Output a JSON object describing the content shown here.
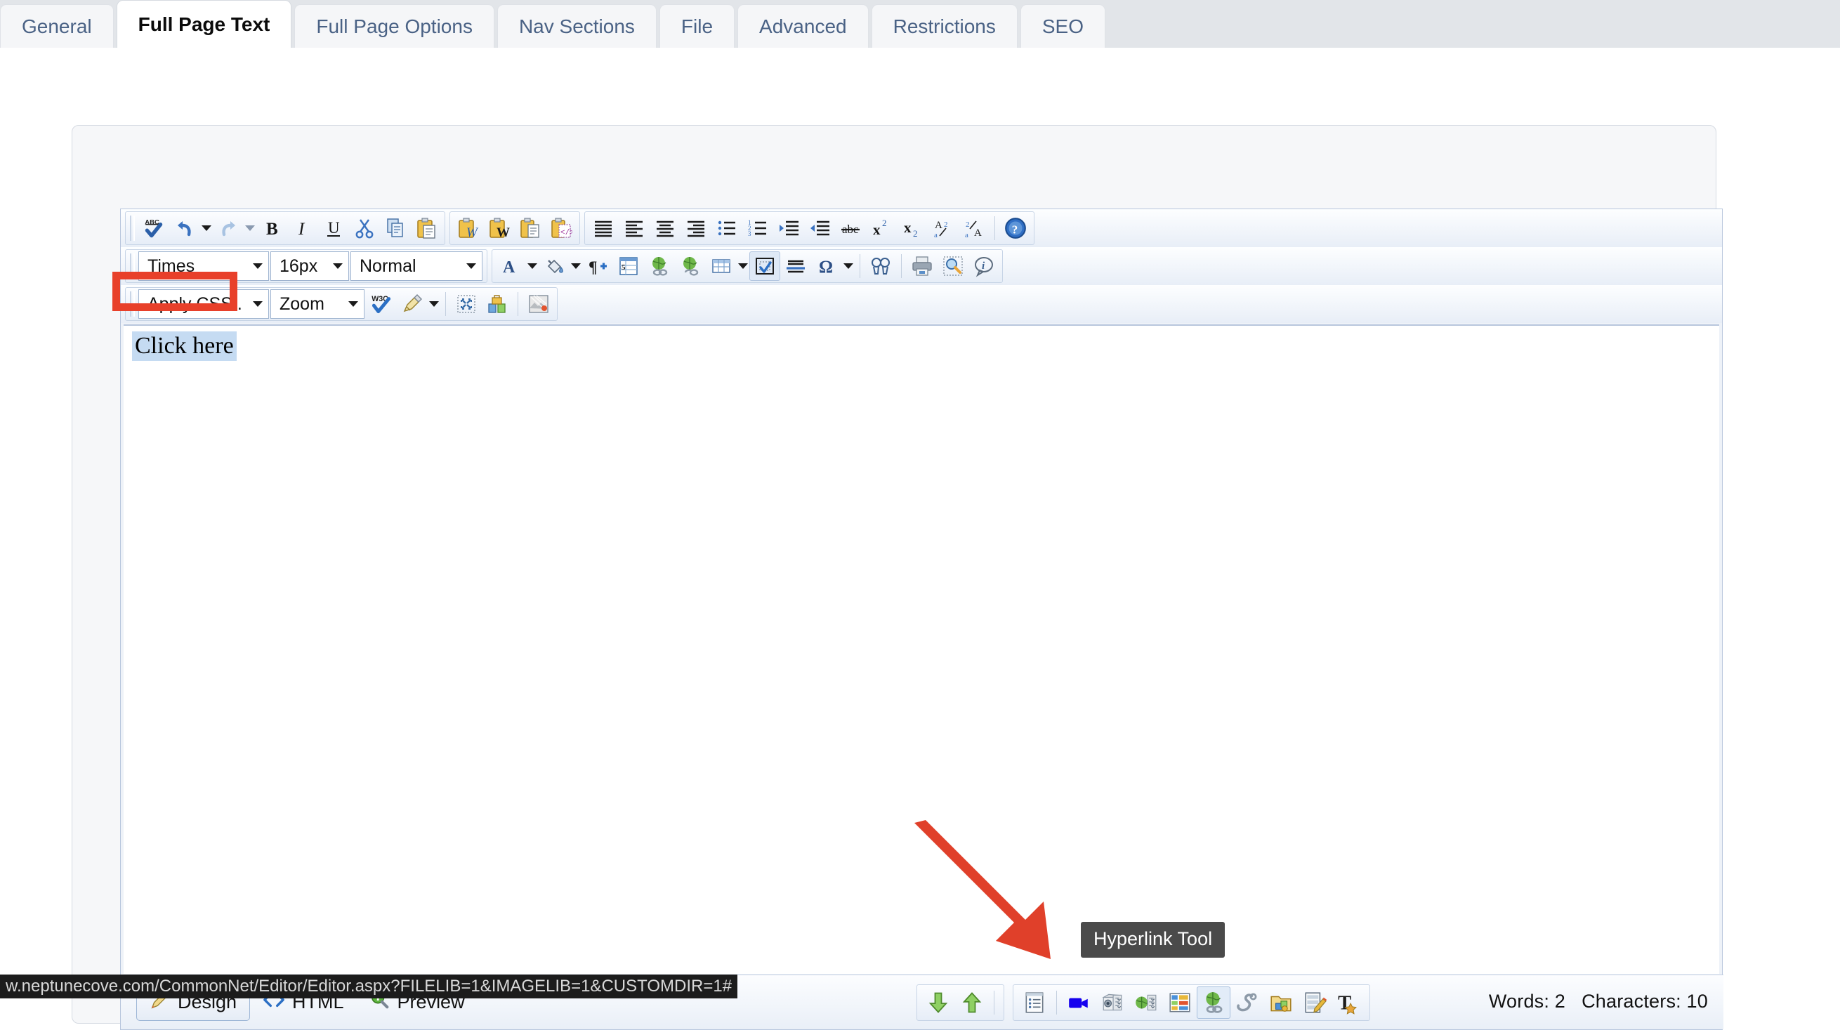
{
  "tabs": [
    {
      "label": "General",
      "active": false
    },
    {
      "label": "Full Page Text",
      "active": true
    },
    {
      "label": "Full Page Options",
      "active": false
    },
    {
      "label": "Nav Sections",
      "active": false
    },
    {
      "label": "File",
      "active": false
    },
    {
      "label": "Advanced",
      "active": false
    },
    {
      "label": "Restrictions",
      "active": false
    },
    {
      "label": "SEO",
      "active": false
    }
  ],
  "toolbar": {
    "row1": [
      {
        "icon": "spellcheck-icon",
        "name": "spell-check-button"
      },
      {
        "icon": "undo-icon",
        "name": "undo-button"
      },
      {
        "icon": "redo-icon",
        "name": "redo-button"
      },
      {
        "icon": "bold-icon",
        "name": "bold-button"
      },
      {
        "icon": "italic-icon",
        "name": "italic-button"
      },
      {
        "icon": "underline-icon",
        "name": "underline-button"
      },
      {
        "icon": "cut-scissors-icon",
        "name": "cut-button"
      },
      {
        "icon": "copy-icon",
        "name": "copy-button"
      },
      {
        "icon": "paste-icon",
        "name": "paste-button"
      },
      {
        "icon": "paste-from-word-icon",
        "name": "paste-from-word-button"
      },
      {
        "icon": "paste-word-clean-icon",
        "name": "paste-word-clean-button"
      },
      {
        "icon": "paste-plain-text-icon",
        "name": "paste-plain-text-button"
      },
      {
        "icon": "paste-html-icon",
        "name": "paste-html-button"
      },
      {
        "icon": "align-justify-icon",
        "name": "justify-button"
      },
      {
        "icon": "align-left-icon",
        "name": "align-left-button"
      },
      {
        "icon": "align-center-icon",
        "name": "align-center-button"
      },
      {
        "icon": "align-right-icon",
        "name": "align-right-button"
      },
      {
        "icon": "bullet-list-icon",
        "name": "bullet-list-button"
      },
      {
        "icon": "numbered-list-icon",
        "name": "numbered-list-button"
      },
      {
        "icon": "indent-icon",
        "name": "indent-button"
      },
      {
        "icon": "outdent-icon",
        "name": "outdent-button"
      },
      {
        "icon": "strikethrough-icon",
        "name": "strikethrough-button"
      },
      {
        "icon": "superscript-icon",
        "name": "superscript-button"
      },
      {
        "icon": "subscript-icon",
        "name": "subscript-button"
      },
      {
        "icon": "sort-az-icon",
        "name": "sort-ascending-button"
      },
      {
        "icon": "sort-za-icon",
        "name": "sort-descending-button"
      },
      {
        "icon": "help-icon",
        "name": "help-button"
      }
    ],
    "row2": {
      "font_family": "Times",
      "font_size": "16px",
      "paragraph_format": "Normal",
      "buttons": [
        {
          "icon": "font-color-icon",
          "name": "font-color-button"
        },
        {
          "icon": "highlight-color-icon",
          "name": "highlight-color-button"
        },
        {
          "icon": "paragraph-add-icon",
          "name": "insert-paragraph-button"
        },
        {
          "icon": "form-field-icon",
          "name": "insert-form-field-button"
        },
        {
          "icon": "insert-hyperlink-icon",
          "name": "insert-hyperlink-button"
        },
        {
          "icon": "remove-hyperlink-icon",
          "name": "remove-hyperlink-button"
        },
        {
          "icon": "table-icon",
          "name": "insert-table-button"
        },
        {
          "icon": "select-region-icon",
          "name": "select-region-button"
        },
        {
          "icon": "horizontal-rule-icon",
          "name": "insert-horizontal-rule-button"
        },
        {
          "icon": "special-character-icon",
          "name": "special-character-button"
        },
        {
          "icon": "find-replace-icon",
          "name": "find-replace-button"
        },
        {
          "icon": "print-icon",
          "name": "print-button"
        },
        {
          "icon": "zoom-preview-icon",
          "name": "zoom-preview-button"
        },
        {
          "icon": "info-icon",
          "name": "info-button"
        }
      ]
    },
    "row3": {
      "apply_css": "Apply CSS ...",
      "zoom": "Zoom",
      "buttons": [
        {
          "icon": "w3c-validate-icon",
          "name": "w3c-validate-button"
        },
        {
          "icon": "clean-brush-icon",
          "name": "clean-code-button"
        },
        {
          "icon": "fullscreen-icon",
          "name": "fullscreen-button"
        },
        {
          "icon": "media-blocks-icon",
          "name": "media-blocks-button"
        },
        {
          "icon": "image-effects-icon",
          "name": "image-effects-button"
        }
      ]
    }
  },
  "content": {
    "text": "Click here",
    "selected": true
  },
  "bottom": {
    "mode_tabs": [
      {
        "label": "Design",
        "icon": "pencil-icon",
        "active": true
      },
      {
        "label": "HTML",
        "icon": "code-brackets-icon",
        "active": false
      },
      {
        "label": "Preview",
        "icon": "magnifier-plus-icon",
        "active": false
      }
    ],
    "tools_group_1": [
      {
        "icon": "arrow-down-green-icon",
        "name": "move-down-button"
      },
      {
        "icon": "arrow-up-green-icon",
        "name": "move-up-button"
      }
    ],
    "tools_group_2": [
      {
        "icon": "document-list-icon",
        "name": "document-properties-button"
      },
      {
        "icon": "video-camera-icon",
        "name": "insert-video-button"
      },
      {
        "icon": "image-library-icon",
        "name": "image-library-button"
      },
      {
        "icon": "web-library-icon",
        "name": "web-library-button"
      },
      {
        "icon": "media-gallery-icon",
        "name": "media-gallery-button"
      },
      {
        "icon": "hyperlink-globe-icon",
        "name": "hyperlink-tool-button",
        "pressed": true
      },
      {
        "icon": "anchor-icon",
        "name": "anchor-tool-button"
      },
      {
        "icon": "folder-components-icon",
        "name": "components-folder-button"
      },
      {
        "icon": "edit-document-icon",
        "name": "edit-document-button"
      },
      {
        "icon": "text-style-icon",
        "name": "text-style-button"
      }
    ],
    "word_count_label": "Words: 2",
    "character_count_label": "Characters: 10"
  },
  "tooltip": {
    "text": "Hyperlink Tool"
  },
  "statusbar": {
    "url": "w.neptunecove.com/CommonNet/Editor/Editor.aspx?FILELIB=1&IMAGELIB=1&CUSTOMDIR=1#"
  },
  "colors": {
    "annotation_red": "#e8402a",
    "tab_text": "#4a6285",
    "selection_blue": "#c5dbf2",
    "tooltip_bg": "#4a4a4a"
  }
}
